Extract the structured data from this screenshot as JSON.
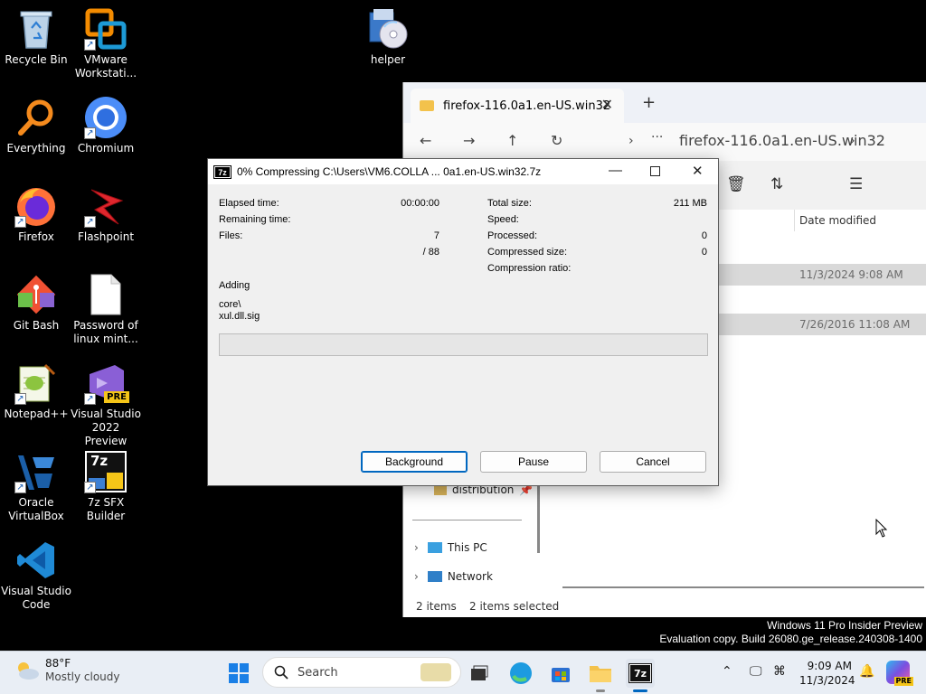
{
  "desktop": {
    "icons": [
      {
        "label": "Recycle Bin"
      },
      {
        "label": "VMware Workstati..."
      },
      {
        "label": "helper"
      },
      {
        "label": "Everything"
      },
      {
        "label": "Chromium"
      },
      {
        "label": "Firefox"
      },
      {
        "label": "Flashpoint"
      },
      {
        "label": "Git Bash"
      },
      {
        "label": "Password of linux mint..."
      },
      {
        "label": "Notepad++"
      },
      {
        "label": "Visual Studio 2022 Preview"
      },
      {
        "label": "Oracle VirtualBox"
      },
      {
        "label": "7z SFX Builder"
      },
      {
        "label": "Visual Studio Code"
      }
    ],
    "vs_badge": "PRE",
    "sfx_badge": "7z"
  },
  "explorer": {
    "tab_title": "firefox-116.0a1.en-US.win32",
    "breadcrumb": "firefox-116.0a1.en-US.win32",
    "column_date": "Date modified",
    "rows": [
      {
        "date": "11/3/2024 9:08 AM"
      },
      {
        "date": "7/26/2016 11:08 AM"
      }
    ],
    "nav": {
      "distribution": "distribution",
      "this_pc": "This PC",
      "network": "Network"
    },
    "status": {
      "items": "2 items",
      "selected": "2 items selected"
    }
  },
  "dialog": {
    "logo": "7z",
    "title": "0% Compressing C:\\Users\\VM6.COLLA ... 0a1.en-US.win32.7z",
    "left": {
      "elapsed_label": "Elapsed time:",
      "elapsed_value": "00:00:00",
      "remaining_label": "Remaining time:",
      "files_label": "Files:",
      "files_value": "7",
      "files_total": "/ 88"
    },
    "right": {
      "total_label": "Total size:",
      "total_value": "211 MB",
      "speed_label": "Speed:",
      "processed_label": "Processed:",
      "processed_value": "0",
      "compressed_label": "Compressed size:",
      "compressed_value": "0",
      "ratio_label": "Compression ratio:"
    },
    "adding_label": "Adding",
    "current_dir": "core\\",
    "current_file": "xul.dll.sig",
    "progress": 0,
    "buttons": {
      "background": "Background",
      "pause": "Pause",
      "cancel": "Cancel"
    }
  },
  "watermark": {
    "line1": "Windows 11 Pro Insider Preview",
    "line2": "Evaluation copy. Build 26080.ge_release.240308-1400"
  },
  "taskbar": {
    "temperature": "88°F",
    "condition": "Mostly cloudy",
    "search_placeholder": "Search",
    "time": "9:09 AM",
    "date": "11/3/2024",
    "sevenzip_label": "7z",
    "copilot_badge": "PRE"
  },
  "colors": {
    "desktop_bg": "#000000",
    "accent": "#0067c0",
    "taskbar_bg": "#e9eef5"
  }
}
